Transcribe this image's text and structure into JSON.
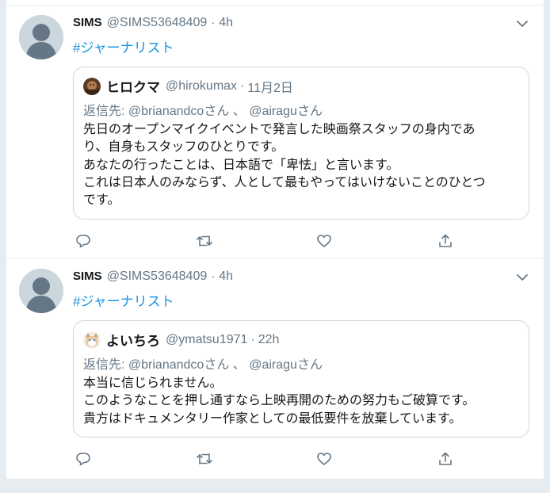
{
  "tweets": [
    {
      "name": "SIMS",
      "handle": "@SIMS53648409",
      "dot": "·",
      "time": "4h",
      "hashtag": "#ジャーナリスト",
      "quote": {
        "name": "ヒロクマ",
        "handle": "@hirokumax",
        "dot": "·",
        "time": "11月2日",
        "reply_prefix": "返信先: ",
        "reply_user1": "@brianandcoさん",
        "reply_sep": " 、 ",
        "reply_user2": "@airaguさん",
        "lines": [
          "先日のオープンマイクイベントで発言した映画祭スタッフの身内であ",
          "り、自身もスタッフのひとりです。",
          "あなたの行ったことは、日本語で「卑怯」と言います。",
          "これは日本人のみならず、人として最もやってはいけないことのひとつ",
          "です。"
        ]
      }
    },
    {
      "name": "SIMS",
      "handle": "@SIMS53648409",
      "dot": "·",
      "time": "4h",
      "hashtag": "#ジャーナリスト",
      "quote": {
        "name": "よいちろ",
        "handle": "@ymatsu1971",
        "dot": "·",
        "time": "22h",
        "reply_prefix": "返信先: ",
        "reply_user1": "@brianandcoさん",
        "reply_sep": " 、 ",
        "reply_user2": "@airaguさん",
        "lines": [
          "本当に信じられません。",
          "このようなことを押し通すなら上映再開のための努力もご破算です。",
          "貴方はドキュメンタリー作家としての最低要件を放棄しています。"
        ]
      }
    }
  ],
  "icons": {
    "reply": "reply-icon",
    "retweet": "retweet-icon",
    "like": "heart-icon",
    "share": "share-icon",
    "more": "chevron-down-icon"
  },
  "colors": {
    "link": "#1b95e0",
    "muted": "#657786",
    "border": "#ccd6dd",
    "background": "#e6ecf0"
  }
}
